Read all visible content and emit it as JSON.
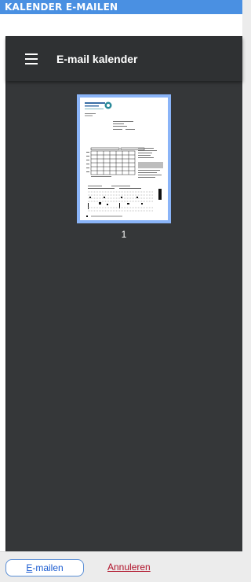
{
  "window": {
    "title": "KALENDER E-MAILEN"
  },
  "viewer": {
    "menu_icon": "hamburger-menu-icon",
    "title": "E-mail kalender",
    "thumbnail": {
      "page_number": "1",
      "selected_color": "#8ab4f8"
    }
  },
  "document": {
    "logo_text": "TrombostoDienst",
    "logo_subtext": "Zeeland"
  },
  "footer": {
    "email_button": "E-mailen",
    "email_mnemonic": "E",
    "email_rest": "-mailen",
    "cancel_button": "Annuleren"
  },
  "colors": {
    "titlebar": "#4a90e2",
    "viewer_bg": "#353739",
    "toolbar_bg": "#2f3133",
    "cancel_text": "#b0122a",
    "email_text": "#1a5bd1"
  }
}
